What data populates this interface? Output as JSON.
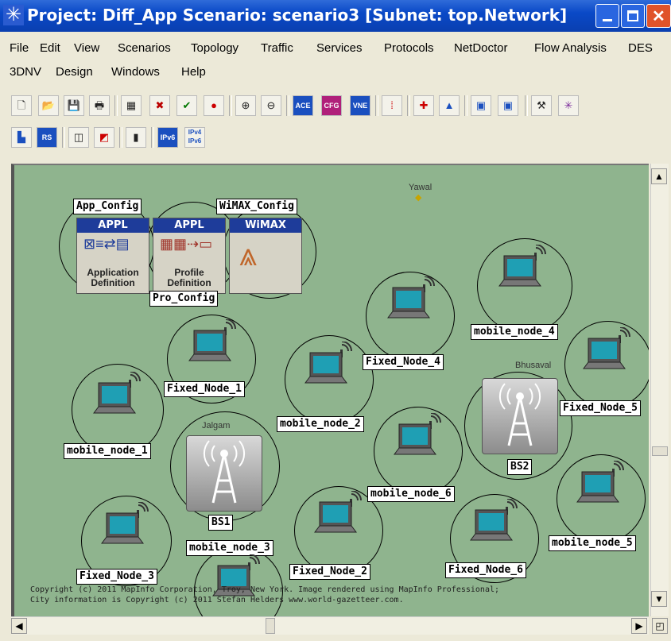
{
  "window": {
    "title": "Project: Diff_App Scenario: scenario3  [Subnet: top.Network]"
  },
  "menu": [
    "File",
    "Edit",
    "View",
    "Scenarios",
    "Topology",
    "Traffic",
    "Services",
    "Protocols",
    "NetDoctor",
    "Flow Analysis",
    "DES",
    "3DNV",
    "Design",
    "Windows",
    "Help"
  ],
  "toolbar": {
    "row1_icons": [
      "new-icon",
      "open-icon",
      "save-icon",
      "print-icon",
      "object-palette-icon",
      "delete-icon",
      "verify-links-icon",
      "fail-node-icon",
      "zoom-in-icon",
      "zoom-out-icon",
      "ace-icon",
      "cfg-icon",
      "vne-icon",
      "traffic-light-icon",
      "configure-run-icon",
      "triangle-icon",
      "grid-a-icon",
      "grid-b-icon",
      "hammer-icon",
      "network-icon"
    ],
    "row1_texts": [
      "ACE",
      "CFG",
      "VNE"
    ],
    "row2_icons": [
      "city-icon",
      "rs-icon",
      "chart-a-icon",
      "chart-b-icon",
      "column-icon",
      "ipv6-icon",
      "ipv4-ipv6-icon"
    ],
    "row2_texts": [
      "RS",
      "IPv6",
      "IPv4",
      "IPv6"
    ]
  },
  "workspace": {
    "cities": [
      "Yawal",
      "Bhusaval",
      "Jalgam"
    ],
    "config_objects": [
      {
        "label": "App_Config",
        "header": "APPL",
        "sub1": "Application",
        "sub2": "Definition"
      },
      {
        "label": "Pro_Config",
        "header": "APPL",
        "sub1": "Profile",
        "sub2": "Definition"
      },
      {
        "label": "WiMAX_Config",
        "header": "WiMAX",
        "sub1": "",
        "sub2": ""
      }
    ],
    "base_stations": [
      "BS1",
      "BS2"
    ],
    "nodes": [
      "Fixed_Node_1",
      "Fixed_Node_4",
      "mobile_node_4",
      "mobile_node_2",
      "Fixed_Node_5",
      "mobile_node_1",
      "mobile_node_6",
      "mobile_node_5",
      "mobile_node_3",
      "Fixed_Node_3",
      "Fixed_Node_2",
      "Fixed_Node_6"
    ],
    "copyright": "Copyright (c) 2011 MapInfo Corporation, Troy, New York. Image rendered using MapInfo Professional;\nCity information is Copyright (c) 2011 Stefan Helders www.world-gazetteer.com."
  },
  "colors": {
    "map": "#8fb48e",
    "title_bar": "#0a49c7",
    "screen": "#1f9fb4"
  }
}
